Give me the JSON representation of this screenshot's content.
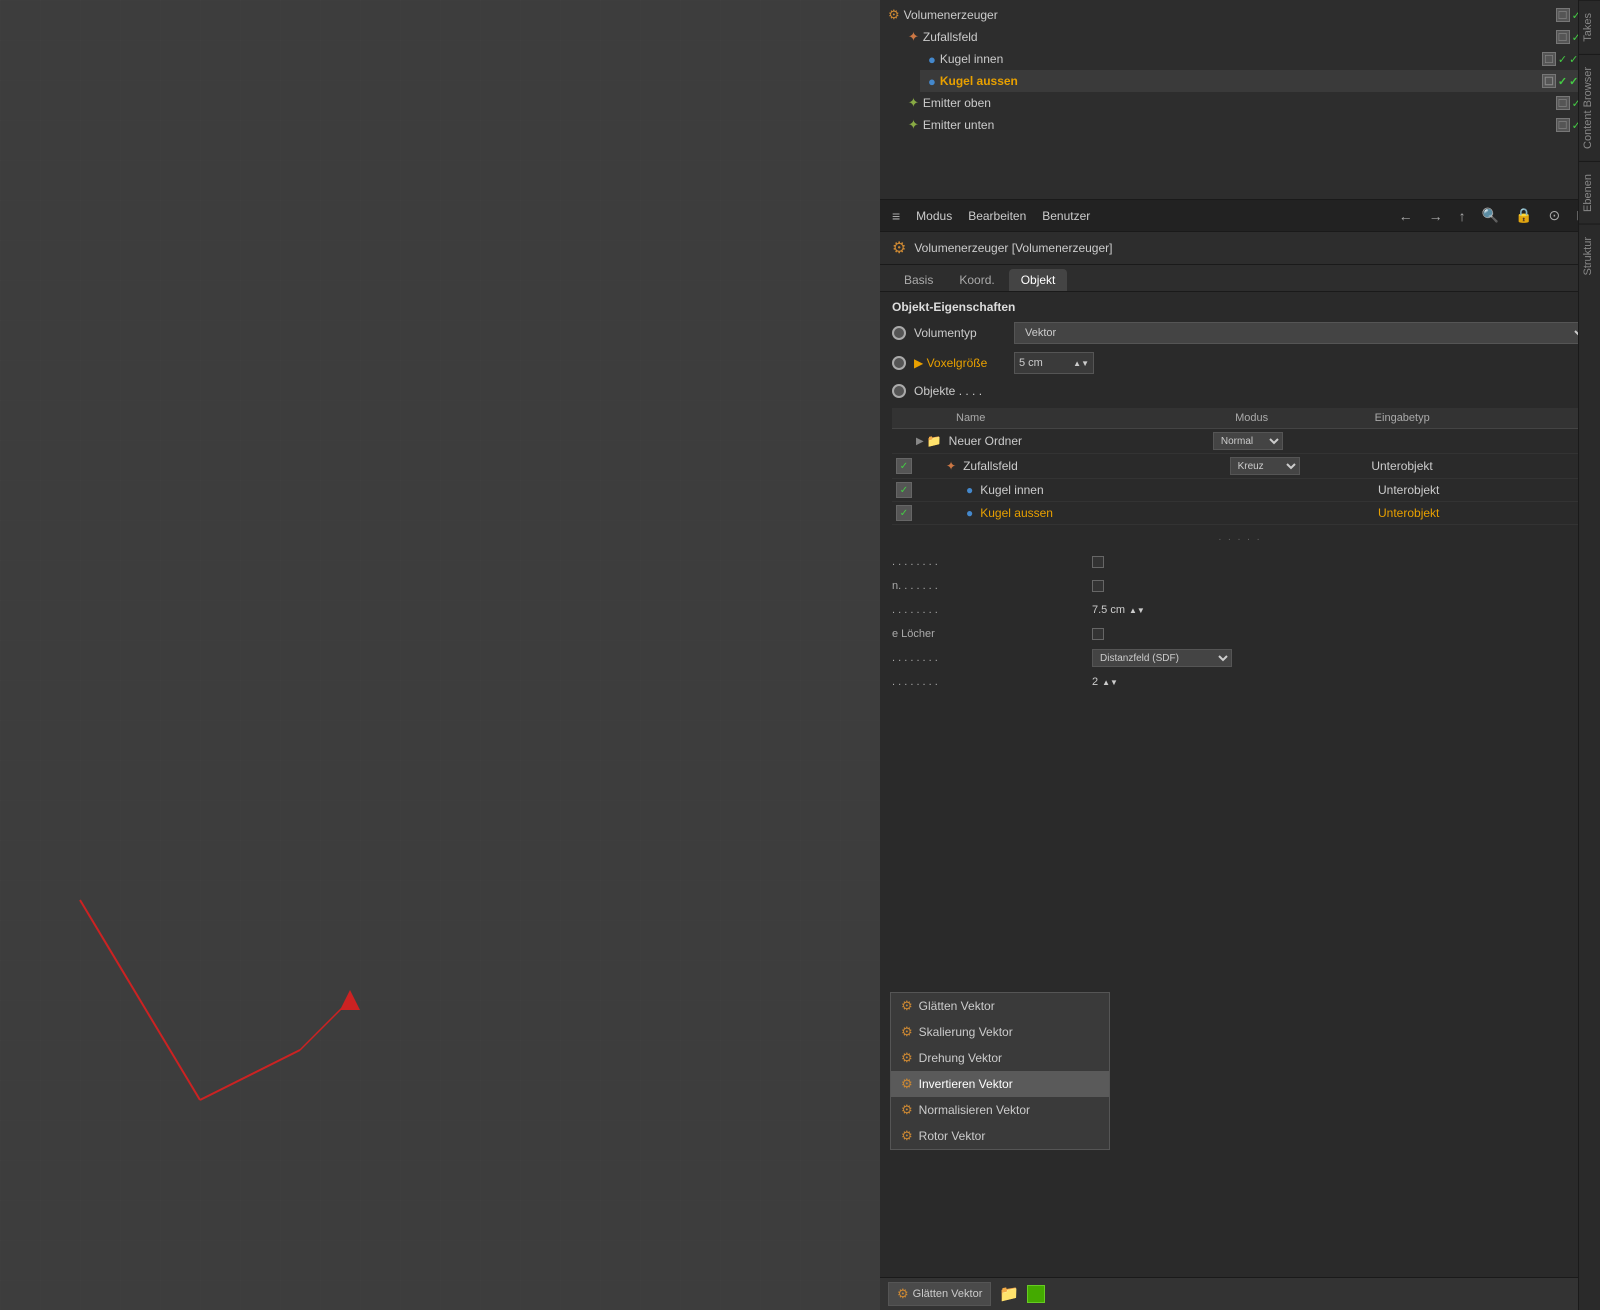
{
  "viewport": {
    "background": "#3d3d3d"
  },
  "scene_tree": {
    "items": [
      {
        "id": "volumenerzeuger",
        "label": "Volumenerzeuger",
        "indent": 0,
        "icon": "⚙",
        "selected": false,
        "controls": [
          "check",
          "check-green",
          "v-green"
        ]
      },
      {
        "id": "zufallsfeld",
        "label": "Zufallsfeld",
        "indent": 1,
        "icon": "✦",
        "selected": false,
        "controls": [
          "check",
          "check-green",
          "v-green"
        ]
      },
      {
        "id": "kugel-innen",
        "label": "Kugel innen",
        "indent": 2,
        "icon": "●",
        "selected": false,
        "controls": [
          "check",
          "check-green",
          "v-green",
          "dot"
        ]
      },
      {
        "id": "kugel-aussen",
        "label": "Kugel aussen",
        "indent": 2,
        "icon": "●",
        "selected": true,
        "controls": [
          "check",
          "check-green",
          "v-green",
          "dot"
        ]
      },
      {
        "id": "emitter-oben",
        "label": "Emitter oben",
        "indent": 1,
        "icon": "✦",
        "selected": false,
        "controls": [
          "check",
          "check-green",
          "v-green"
        ]
      },
      {
        "id": "emitter-unten",
        "label": "Emitter unten",
        "indent": 1,
        "icon": "✦",
        "selected": false,
        "controls": [
          "check",
          "check-green",
          "v-green"
        ]
      }
    ]
  },
  "panel_toolbar": {
    "menu_items": [
      "Modus",
      "Bearbeiten",
      "Benutzer"
    ],
    "hamburger": "≡"
  },
  "object_title": {
    "icon": "⚙",
    "label": "Volumenerzeuger [Volumenerzeuger]"
  },
  "tabs": {
    "items": [
      "Basis",
      "Koord.",
      "Objekt"
    ],
    "active": "Objekt"
  },
  "section": {
    "title": "Objekt-Eigenschaften"
  },
  "properties": {
    "volumentyp_label": "Volumentyp",
    "volumentyp_value": "Vektor",
    "voxelgroesse_label": "Voxelgröße",
    "voxelgroesse_value": "5 cm",
    "objekte_label": "Objekte . . . ."
  },
  "table": {
    "headers": {
      "name": "Name",
      "modus": "Modus",
      "eingabetyp": "Eingabetyp"
    },
    "rows": [
      {
        "id": "neuer-ordner",
        "checkbox": false,
        "indent": 0,
        "icon": "📁",
        "label": "Neuer Ordner",
        "modus": "Normal",
        "eingabetyp": ""
      },
      {
        "id": "zufallsfeld-row",
        "checkbox": true,
        "indent": 1,
        "icon": "✦",
        "label": "Zufallsfeld",
        "modus": "Kreuz",
        "eingabetyp": "Unterobjekt"
      },
      {
        "id": "kugel-innen-row",
        "checkbox": true,
        "indent": 2,
        "icon": "●",
        "label": "Kugel innen",
        "modus": "",
        "eingabetyp": "Unterobjekt"
      },
      {
        "id": "kugel-aussen-row",
        "checkbox": true,
        "indent": 2,
        "icon": "●",
        "label": "Kugel aussen",
        "modus": "",
        "eingabetyp": "Unterobjekt",
        "selected": true
      }
    ]
  },
  "extra_properties": [
    {
      "label": "........",
      "value_checkbox": false
    },
    {
      "label": "n......",
      "value_checkbox": false
    },
    {
      "label": "........",
      "value": "7.5 cm"
    },
    {
      "label": "e Löcher",
      "value_checkbox": false
    },
    {
      "label": "........",
      "value_dropdown": "Distanzfeld (SDF)"
    },
    {
      "label": "........",
      "value": "2"
    }
  ],
  "bottom_toolbar": {
    "main_label": "Glätten Vektor",
    "add_icon": "➕",
    "green_icon": "■"
  },
  "dropdown_menu": {
    "items": [
      {
        "id": "glatten-vektor",
        "label": "Glätten Vektor",
        "icon": "⚙"
      },
      {
        "id": "skalierung-vektor",
        "label": "Skalierung Vektor",
        "icon": "⚙"
      },
      {
        "id": "drehung-vektor",
        "label": "Drehung Vektor",
        "icon": "⚙"
      },
      {
        "id": "invertieren-vektor",
        "label": "Invertieren Vektor",
        "icon": "⚙",
        "highlighted": true
      },
      {
        "id": "normalisieren-vektor",
        "label": "Normalisieren Vektor",
        "icon": "⚙"
      },
      {
        "id": "rotor-vektor",
        "label": "Rotor Vektor",
        "icon": "⚙"
      }
    ]
  },
  "side_tabs": {
    "items": [
      "Takes",
      "Content Browser",
      "Ebenen",
      "Struktur"
    ]
  },
  "normal_dropdown": {
    "value": "Normal"
  }
}
